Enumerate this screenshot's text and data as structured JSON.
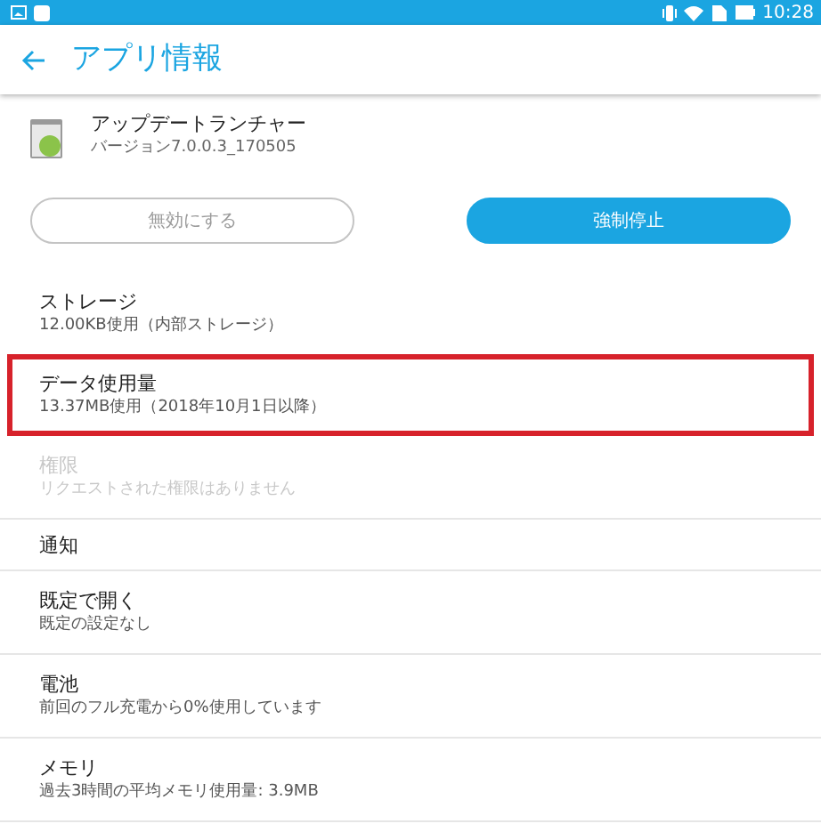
{
  "status_bar": {
    "time": "10:28"
  },
  "header": {
    "title": "アプリ情報"
  },
  "app": {
    "name": "アップデートランチャー",
    "version": "バージョン7.0.0.3_170505"
  },
  "buttons": [
    {
      "label": "無効にする",
      "kind": "outline",
      "disabled": true
    },
    {
      "label": "強制停止",
      "kind": "filled",
      "disabled": false
    }
  ],
  "groups": [
    [
      {
        "title": "ストレージ",
        "subtitle": "12.00KB使用（内部ストレージ）",
        "disabled": false,
        "highlighted": false
      },
      {
        "title": "データ使用量",
        "subtitle": "13.37MB使用（2018年10月1日以降）",
        "disabled": false,
        "highlighted": true
      },
      {
        "title": "権限",
        "subtitle": "リクエストされた権限はありません",
        "disabled": true,
        "highlighted": false
      }
    ],
    [
      {
        "title": "通知",
        "disabled": false,
        "highlighted": false
      }
    ],
    [
      {
        "title": "既定で開く",
        "subtitle": "既定の設定なし",
        "disabled": false,
        "highlighted": false
      }
    ],
    [
      {
        "title": "電池",
        "subtitle": "前回のフル充電から0%使用しています",
        "disabled": false,
        "highlighted": false
      }
    ],
    [
      {
        "title": "メモリ",
        "subtitle": "過去3時間の平均メモリ使用量: 3.9MB",
        "disabled": false,
        "highlighted": false
      }
    ]
  ]
}
